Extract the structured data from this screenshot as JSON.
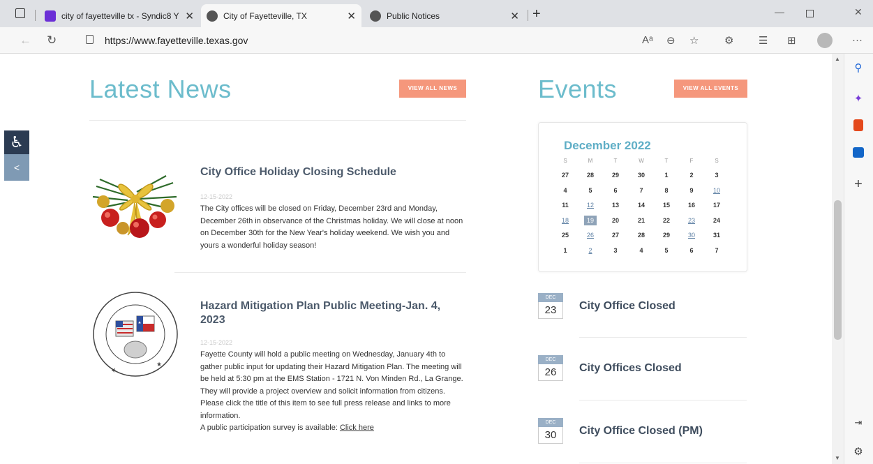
{
  "browser": {
    "tabs": [
      {
        "title": "city of fayetteville tx - Syndic8 Y",
        "favicon_color": "#6b2fd6"
      },
      {
        "title": "City of Fayetteville, TX",
        "favicon_color": "#555555"
      },
      {
        "title": "Public Notices",
        "favicon_color": "#555555"
      }
    ],
    "url": "https://www.fayetteville.texas.gov"
  },
  "news": {
    "heading": "Latest News",
    "view_all": "VIEW ALL NEWS",
    "items": [
      {
        "title": "City Office Holiday Closing Schedule",
        "date": "12-15-2022",
        "body": "The City offices will be closed on Friday, December 23rd and Monday, December 26th in observance of the Christmas holiday. We will close at noon on December 30th for the New Year's holiday weekend. We wish you and yours a wonderful holiday season!"
      },
      {
        "title": "Hazard Mitigation Plan Public Meeting-Jan. 4, 2023",
        "date": "12-15-2022",
        "body": "Fayette County will hold a public meeting on Wednesday, January 4th to gather public input for updating their Hazard Mitigation Plan. The meeting will be held at 5:30 pm at the EMS Station - 1721 N. Von Minden Rd., La Grange.  They will provide a project overview and solicit information from citizens. Please click the title of this item to see full press release and links to more information.",
        "survey_text": "A public participation survey is available:",
        "survey_link": "Click here",
        "seal_text_top": "COUNTY OF FAYETTE",
        "seal_text_bottom": "STATE OF TEXAS"
      }
    ]
  },
  "events": {
    "heading": "Events",
    "view_all": "VIEW ALL EVENTS",
    "calendar": {
      "title": "December 2022",
      "dow": [
        "S",
        "M",
        "T",
        "W",
        "T",
        "F",
        "S"
      ],
      "weeks": [
        [
          "27",
          "28",
          "29",
          "30",
          "1",
          "2",
          "3"
        ],
        [
          "4",
          "5",
          "6",
          "7",
          "8",
          "9",
          "10"
        ],
        [
          "11",
          "12",
          "13",
          "14",
          "15",
          "16",
          "17"
        ],
        [
          "18",
          "19",
          "20",
          "21",
          "22",
          "23",
          "24"
        ],
        [
          "25",
          "26",
          "27",
          "28",
          "29",
          "30",
          "31"
        ],
        [
          "1",
          "2",
          "3",
          "4",
          "5",
          "6",
          "7"
        ]
      ]
    },
    "items": [
      {
        "month": "DEC",
        "day": "23",
        "title": "City Office Closed"
      },
      {
        "month": "DEC",
        "day": "26",
        "title": "City Offices Closed"
      },
      {
        "month": "DEC",
        "day": "30",
        "title": "City Office Closed (PM)"
      }
    ]
  }
}
